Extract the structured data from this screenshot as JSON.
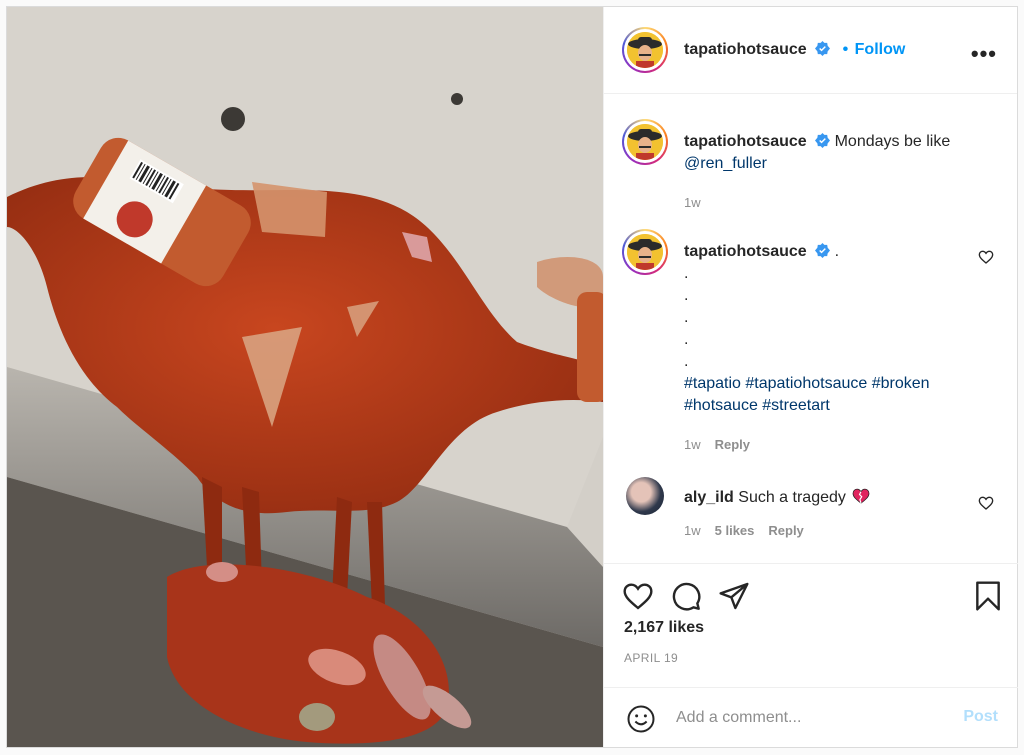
{
  "post": {
    "author": "tapatiohotsauce",
    "follow_label": "Follow",
    "dot": "•",
    "more_label": "•••",
    "caption": {
      "author": "tapatiohotsauce",
      "text": "Mondays be like",
      "mention": "@ren_fuller",
      "time": "1w"
    },
    "comments": [
      {
        "author": "tapatiohotsauce",
        "lines": [
          ".",
          ".",
          ".",
          ".",
          ".",
          "."
        ],
        "hashtags_line1": "#tapatio #tapatiohotsauce #broken",
        "hashtags_line2": "#hotsauce #streetart",
        "time": "1w",
        "reply_label": "Reply"
      },
      {
        "author": "aly_ild",
        "text": "Such a tragedy",
        "emoji": "❤️‍🩹",
        "time": "1w",
        "likes": "5 likes",
        "reply_label": "Reply"
      }
    ],
    "likes": "2,167 likes",
    "date": "APRIL 19",
    "comment_placeholder": "Add a comment...",
    "post_label": "Post"
  },
  "icons": [
    "verified-badge-icon",
    "more-options-icon",
    "heart-icon",
    "comment-icon",
    "share-icon",
    "bookmark-icon",
    "emoji-icon",
    "broken-heart-icon"
  ],
  "colors": {
    "accent": "#0095f6",
    "link": "#00376b",
    "muted": "#8e8e8e",
    "sauce": "#b83a17"
  }
}
